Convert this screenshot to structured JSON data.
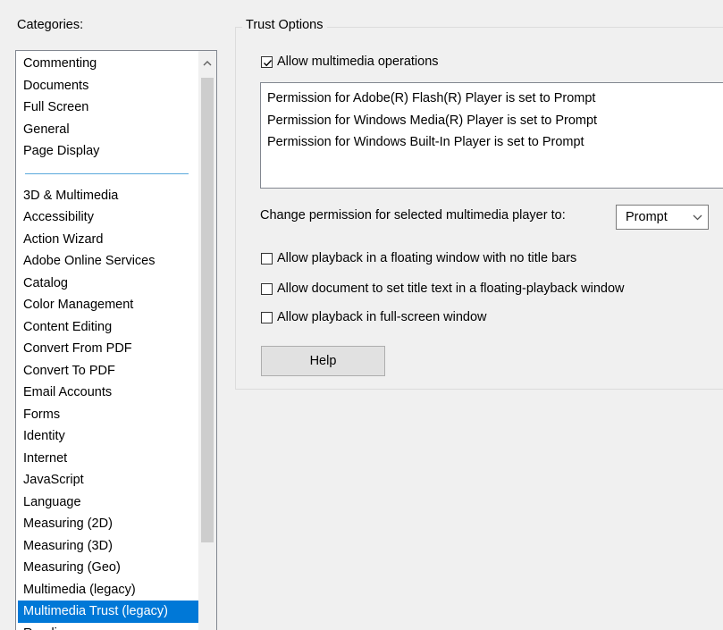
{
  "categories": {
    "label": "Categories:",
    "group_top": [
      "Commenting",
      "Documents",
      "Full Screen",
      "General",
      "Page Display"
    ],
    "group_bottom": [
      "3D & Multimedia",
      "Accessibility",
      "Action Wizard",
      "Adobe Online Services",
      "Catalog",
      "Color Management",
      "Content Editing",
      "Convert From PDF",
      "Convert To PDF",
      "Email Accounts",
      "Forms",
      "Identity",
      "Internet",
      "JavaScript",
      "Language",
      "Measuring (2D)",
      "Measuring (3D)",
      "Measuring (Geo)",
      "Multimedia (legacy)",
      "Multimedia Trust (legacy)",
      "Reading"
    ],
    "selected": "Multimedia Trust (legacy)"
  },
  "trust": {
    "title": "Trust Options",
    "allow_multimedia": {
      "label": "Allow multimedia operations",
      "checked": true
    },
    "permissions": [
      "Permission for Adobe(R) Flash(R) Player is set to Prompt",
      "Permission for Windows Media(R) Player is set to Prompt",
      "Permission for Windows Built-In Player is set to Prompt"
    ],
    "change_label": "Change permission for selected multimedia player to:",
    "select_value": "Prompt",
    "options": [
      {
        "label": "Allow playback in a floating window with no title bars",
        "checked": false
      },
      {
        "label": "Allow document to set title text in a floating-playback window",
        "checked": false
      },
      {
        "label": "Allow playback in full-screen window",
        "checked": false
      }
    ],
    "help_label": "Help"
  },
  "colors": {
    "selection": "#0078d7",
    "separator": "#5aa9dc"
  }
}
